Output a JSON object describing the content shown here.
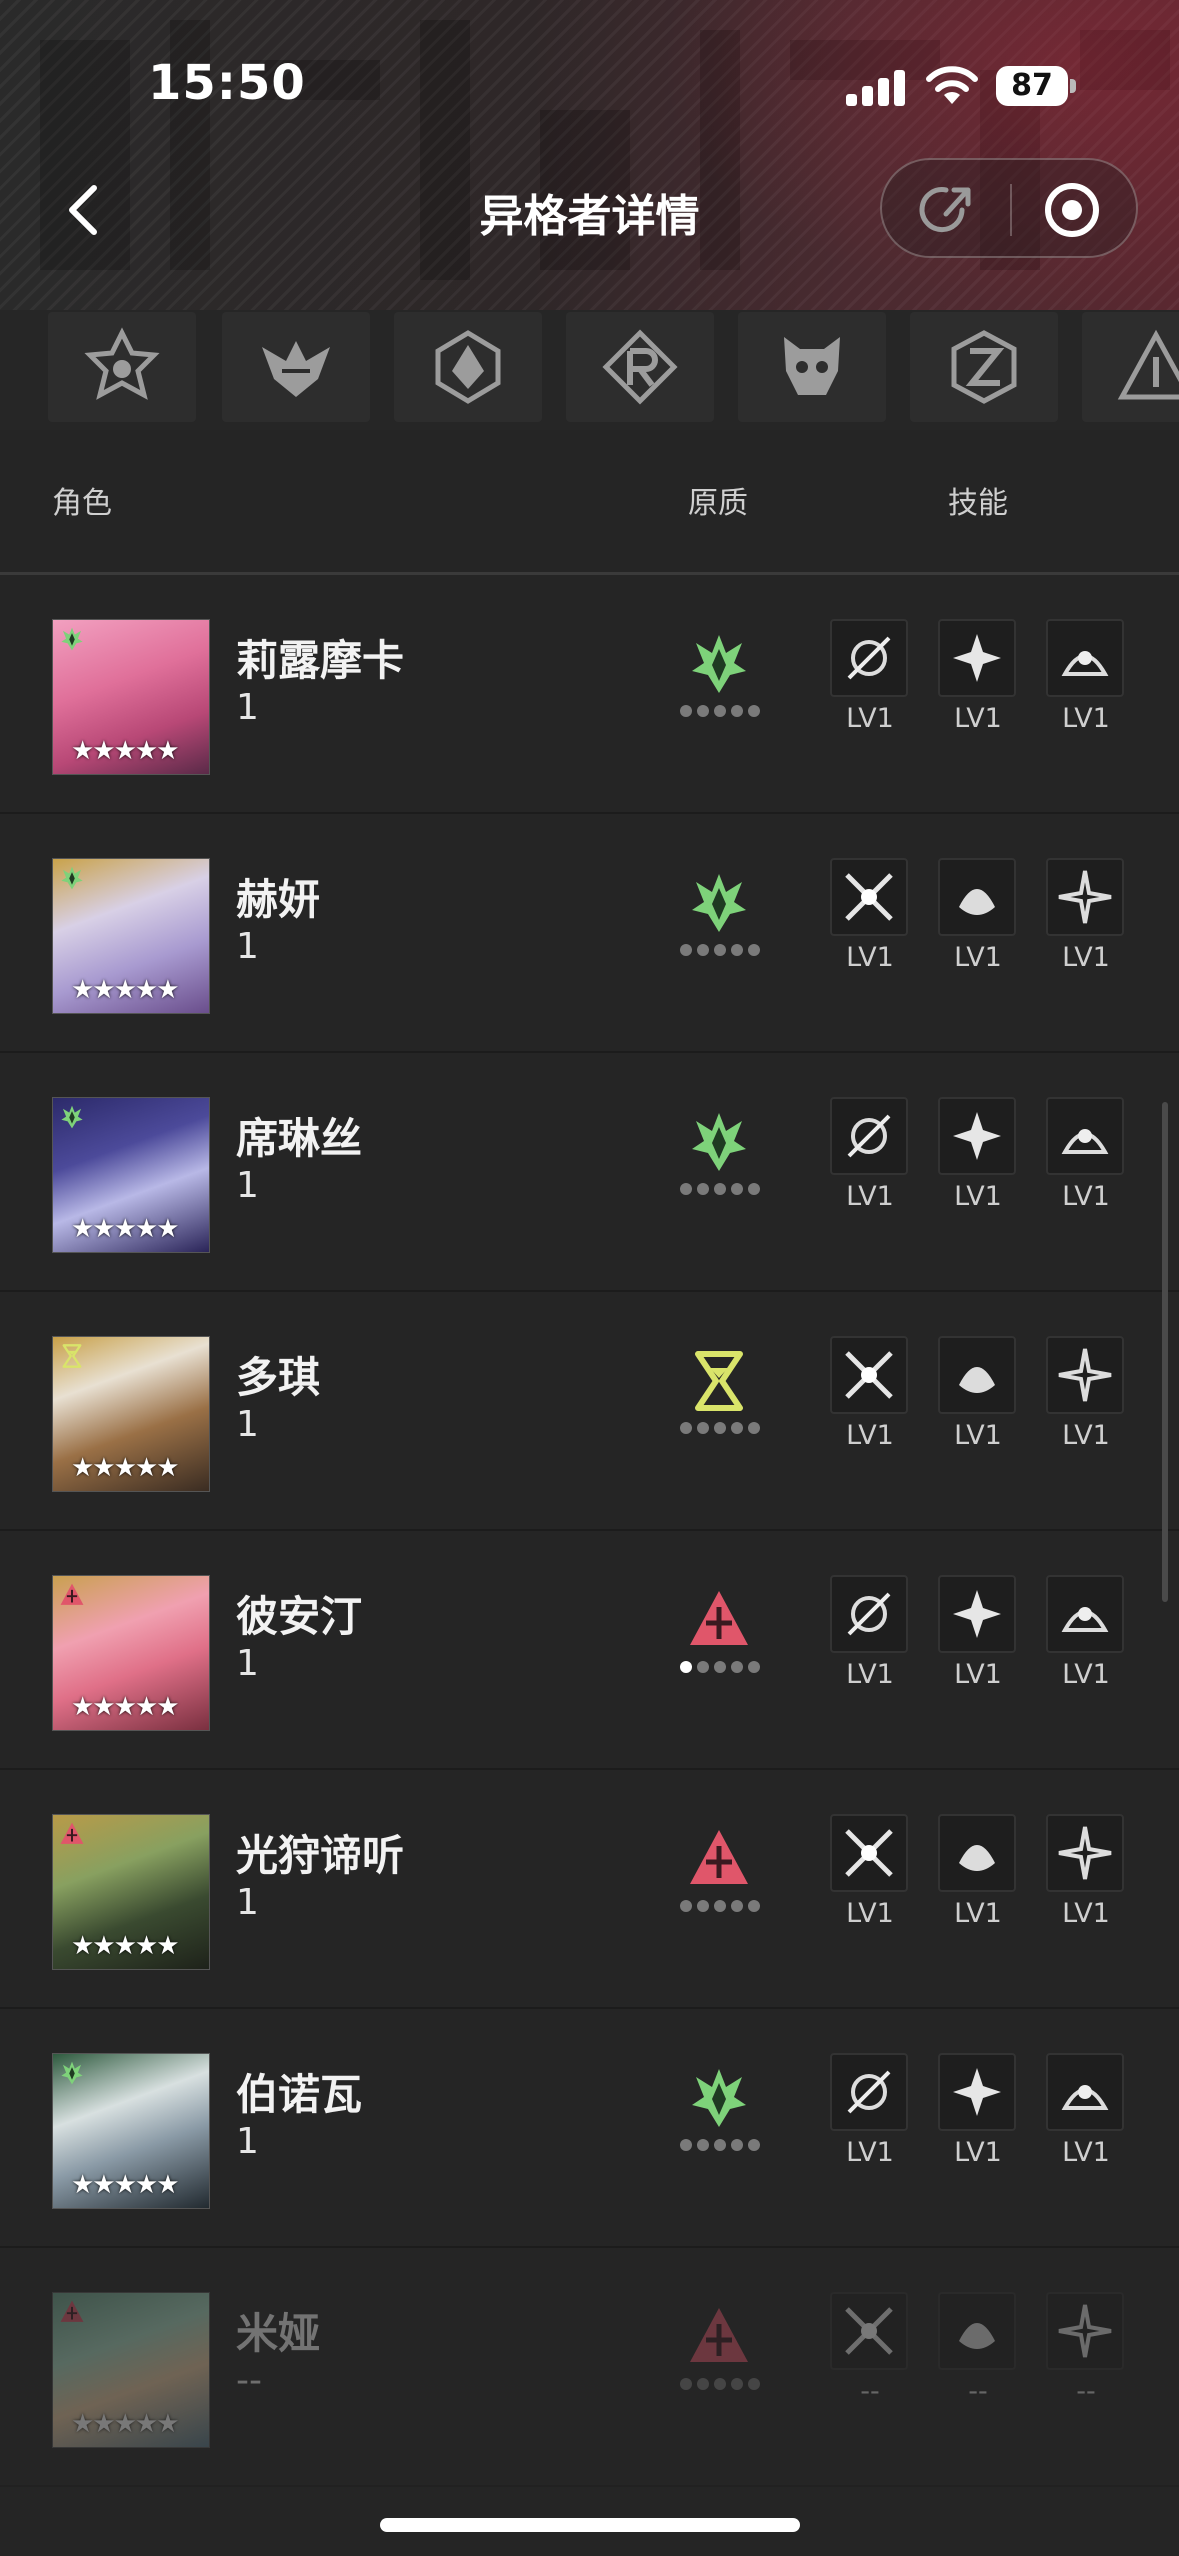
{
  "status": {
    "time": "15:50",
    "battery": "87"
  },
  "nav": {
    "title": "异格者详情"
  },
  "columns": {
    "role": "角色",
    "quality": "原质",
    "skills": "技能"
  },
  "factions": [
    "faction-emblem-1",
    "faction-emblem-2",
    "faction-emblem-3",
    "faction-emblem-4",
    "faction-emblem-5",
    "faction-emblem-6",
    "faction-emblem-7"
  ],
  "colors": {
    "green_element": "#7ed27a",
    "yellow_element": "#d9e46a",
    "red_element": "#e0566a"
  },
  "characters": [
    {
      "name": "莉露摩卡",
      "level": "1",
      "element": "green",
      "quality_level": 0,
      "skills": [
        "LV1",
        "LV1",
        "LV1"
      ],
      "unlocked": true
    },
    {
      "name": "赫妍",
      "level": "1",
      "element": "green",
      "quality_level": 0,
      "skills": [
        "LV1",
        "LV1",
        "LV1"
      ],
      "unlocked": true
    },
    {
      "name": "席琳丝",
      "level": "1",
      "element": "green",
      "quality_level": 0,
      "skills": [
        "LV1",
        "LV1",
        "LV1"
      ],
      "unlocked": true
    },
    {
      "name": "多琪",
      "level": "1",
      "element": "yellow",
      "quality_level": 0,
      "skills": [
        "LV1",
        "LV1",
        "LV1"
      ],
      "unlocked": true
    },
    {
      "name": "彼安汀",
      "level": "1",
      "element": "red",
      "quality_level": 1,
      "skills": [
        "LV1",
        "LV1",
        "LV1"
      ],
      "unlocked": true
    },
    {
      "name": "光狩谛听",
      "level": "1",
      "element": "red",
      "quality_level": 0,
      "skills": [
        "LV1",
        "LV1",
        "LV1"
      ],
      "unlocked": true
    },
    {
      "name": "伯诺瓦",
      "level": "1",
      "element": "green",
      "quality_level": 0,
      "skills": [
        "LV1",
        "LV1",
        "LV1"
      ],
      "unlocked": true
    },
    {
      "name": "米娅",
      "level": "--",
      "element": "red",
      "quality_level": 0,
      "skills": [
        "--",
        "--",
        "--"
      ],
      "unlocked": false
    }
  ],
  "star_text": "★★★★★"
}
